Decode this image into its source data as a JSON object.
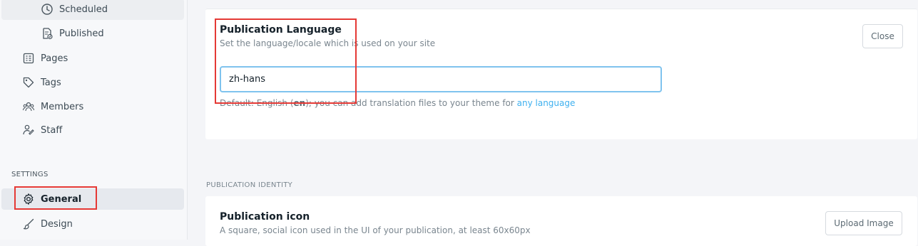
{
  "sidebar": {
    "sub_items": [
      {
        "label": "Scheduled",
        "icon": "clock-icon"
      },
      {
        "label": "Published",
        "icon": "published-doc-icon"
      }
    ],
    "items": [
      {
        "label": "Pages",
        "icon": "pages-icon"
      },
      {
        "label": "Tags",
        "icon": "tag-icon"
      },
      {
        "label": "Members",
        "icon": "members-icon"
      },
      {
        "label": "Staff",
        "icon": "staff-icon"
      }
    ],
    "settings_heading": "SETTINGS",
    "settings_items": [
      {
        "label": "General",
        "icon": "gear-icon",
        "active": true
      },
      {
        "label": "Design",
        "icon": "brush-icon",
        "active": false
      }
    ]
  },
  "language_card": {
    "title": "Publication Language",
    "description": "Set the language/locale which is used on your site",
    "input_value": "zh-hans",
    "hint_prefix": "Default: English (",
    "hint_code": "en",
    "hint_middle": "); you can add translation files to your theme for ",
    "hint_link": "any language",
    "close_label": "Close"
  },
  "identity": {
    "group_heading": "PUBLICATION IDENTITY",
    "icon_title": "Publication icon",
    "icon_description": "A square, social icon used in the UI of your publication, at least 60x60px",
    "upload_label": "Upload Image"
  },
  "colors": {
    "accent": "#3eb0ef",
    "annotation": "#e53935"
  }
}
